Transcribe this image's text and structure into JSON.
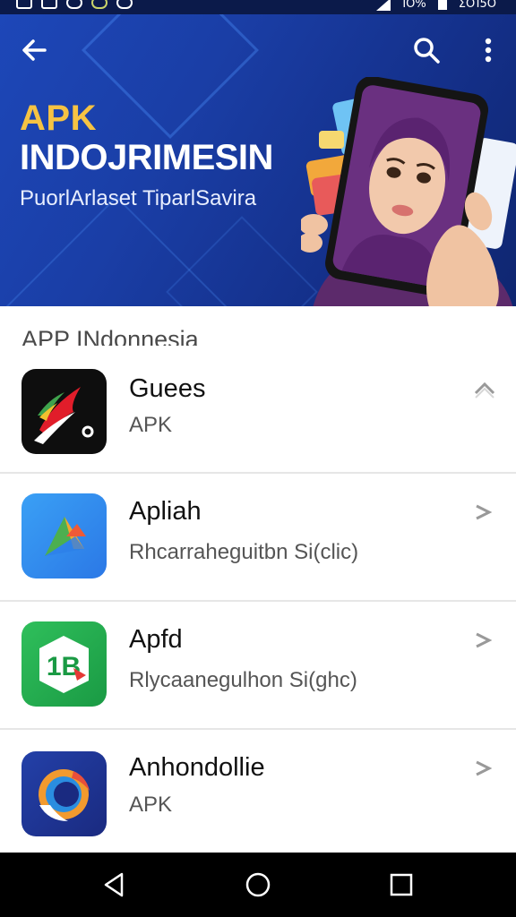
{
  "status_bar": {
    "time": "ΣΟΊ5Ο",
    "battery": "ΊΟ%"
  },
  "hero": {
    "title_line1": "APK",
    "title_line2": "INDOJRIMESIN",
    "subtitle": "PuorlArlaset TiparlSavira"
  },
  "list": {
    "section_title": "APP INdonnesia",
    "items": [
      {
        "title": "Guees",
        "subtitle": "APK",
        "chevron": "chevron-up-icon"
      },
      {
        "title": "Apliah",
        "subtitle": "Rhcarraheguitbn Si(clic)",
        "chevron": "chevron-right-icon"
      },
      {
        "title": "Apfd",
        "subtitle": "Rlycaanegulhon Si(ghc)",
        "chevron": "chevron-right-icon"
      },
      {
        "title": "Anhondollie",
        "subtitle": "APK",
        "chevron": "chevron-right-icon"
      }
    ]
  },
  "colors": {
    "hero_bg": "#1a3ea6",
    "title_accent": "#f6c343",
    "nav_bg": "#000000"
  },
  "nav": {
    "icons": [
      "back-triangle-icon",
      "home-circle-icon",
      "recents-square-icon"
    ]
  }
}
